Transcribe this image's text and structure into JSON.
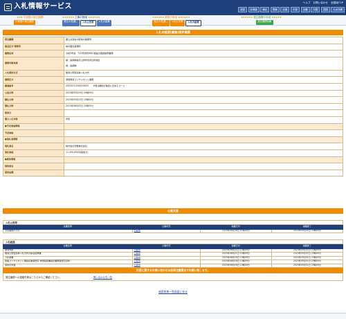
{
  "header": {
    "title": "入札情報サービス",
    "links": [
      "ヘルプ",
      "お問い合わせ",
      "全国版TOP"
    ],
    "regions": [
      "全国",
      "北海道",
      "東北",
      "関東",
      "北陸",
      "中部",
      "近畿",
      "中国",
      "四国",
      "九州沖縄"
    ]
  },
  "nav": {
    "groups": [
      {
        "title": "中部国の発注機関",
        "tabs": [
          "中部国の発注機関"
        ],
        "active": -1,
        "color": "#f08a00"
      },
      {
        "title": "工事の検索",
        "tabs": [
          "発注の見通し",
          "入札公告等",
          "入札の結果"
        ],
        "active": 1,
        "color": "#4f75b8"
      },
      {
        "title": "業務の検索",
        "tabs": [
          "発注の見通し",
          "入札公告等",
          "入札の結果"
        ],
        "active": 2,
        "color": "#f08a00"
      },
      {
        "title": "発注機関の地域",
        "tabs": [
          "発注機関情報"
        ],
        "active": -1,
        "color": "#3fa64a"
      }
    ]
  },
  "detail": {
    "title": "入札の経過(業務)案件概要",
    "rows": [
      {
        "label": "発注機関",
        "value": "国土交通省中部地方整備局"
      },
      {
        "label": "拠点区分-事務所",
        "value": "岐阜国道事務所"
      },
      {
        "label": "業務名称",
        "value": "令和5年度　T12号伊勢市外1施設の確認説明業務"
      },
      {
        "label": "業務対象地域",
        "value": "岐・奥飛騨奥高山伊勢市周辺町地区\n　\n岐・奥飛騨",
        "tall": true
      },
      {
        "label": "入札契約方式",
        "value": "簡易公募型競争入札方式"
      },
      {
        "label": "業務区分",
        "value": "測量関係コンサルタント業務"
      },
      {
        "label": "調達番号",
        "value": "20230715300200001　　※発注機関が独自に定めるコード"
      },
      {
        "label": "公告日時",
        "value": "2023年05月29日 09時00分"
      },
      {
        "label": "開札日時",
        "value": "2023年05月15日 10時00分"
      },
      {
        "label": "開札日時",
        "value": "2023年06月02日 10時00分"
      },
      {
        "label": "契約日",
        "value": ""
      },
      {
        "label": "電子入札対象",
        "value": "対象"
      },
      {
        "label": "■予定価格情報",
        "value": "",
        "sub": true
      },
      {
        "label": "予定価格",
        "value": ""
      },
      {
        "label": "■落札者情報",
        "value": "",
        "sub": true
      },
      {
        "label": "落札者名",
        "value": "株式会社測量株式会社"
      },
      {
        "label": "落札価格",
        "value": "12,450,000円(税抜き)"
      },
      {
        "label": "■契約情報",
        "value": "",
        "sub": true
      },
      {
        "label": "契約者名",
        "value": ""
      },
      {
        "label": "契約金額",
        "value": ""
      }
    ]
  },
  "publications": {
    "title": "公開文書",
    "columns": [
      "文書名称",
      "公開状況",
      "掲載日付",
      "掲載終了"
    ],
    "sections": [
      {
        "heading": "入札公告等",
        "rows": [
          [
            "手続開始の公示",
            "公開中",
            "2023年04月28日 07時00分",
            "2023年05月31日 23時00分"
          ]
        ]
      },
      {
        "heading": "入札経過",
        "rows": [
          [
            "積算内訳",
            "公開中",
            "2023年06月21日 13時00分",
            "2023年05月31日 23時00分"
          ],
          [
            "簡易公募型競争入札方式の指名結果書",
            "公開中",
            "2023年06月21日 13時00分",
            "2023年05月31日 23時00分"
          ],
          [
            "入札調書",
            "公開中",
            "2023年06月16日 13時00分",
            "2023年05月31日 23時00分"
          ],
          [
            "建設コンサルタント等指名業者選定 技術提案書提出業務者選定資料",
            "公開中",
            "2023年06月16日 13時00分",
            "2023年05月31日 23時00分"
          ],
          [
            "契約の内容",
            "公開中",
            "2023年06月16日 13時00分",
            "2023年05月31日 23時00分"
          ]
        ]
      }
    ]
  },
  "contact": {
    "title": "内容に関するお問い合わせは各発注機関までお願い致します。",
    "text": "発注機関への連絡先等はこちらからご確認ください。",
    "link": "問い合わせ先一覧"
  },
  "back_link": "検索結果一覧画面に戻る",
  "colors": {
    "navy": "#1f3f7a",
    "orange": "#f08a00",
    "label_bg": "#fbe7cb"
  }
}
